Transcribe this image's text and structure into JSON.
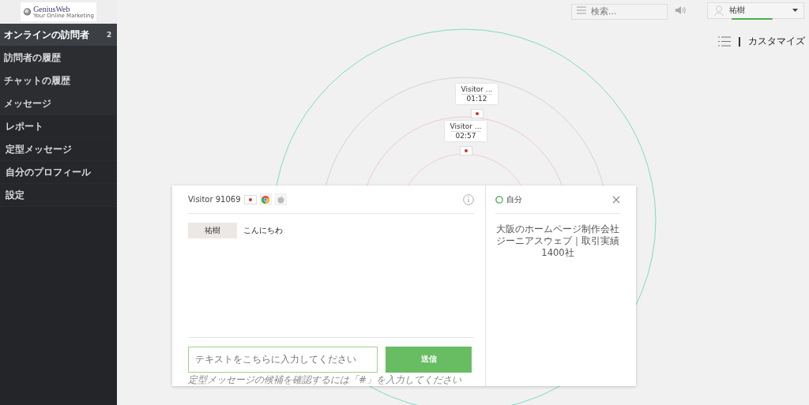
{
  "logo": {
    "name": "GeniusWeb",
    "tagline": "Your Online Marketing"
  },
  "sidebar": {
    "items": [
      {
        "label": "オンラインの訪問者",
        "badge": "2",
        "selected": true
      },
      {
        "label": "訪問者の履歴",
        "selected": false
      },
      {
        "label": "チャットの履歴",
        "selected": false
      },
      {
        "label": "メッセージ",
        "selected": false
      },
      {
        "label": "レポート",
        "selected": false
      },
      {
        "label": "定型メッセージ",
        "selected": false
      },
      {
        "label": "自分のプロフィール",
        "selected": false
      },
      {
        "label": "設定",
        "selected": false
      }
    ]
  },
  "header": {
    "search": {
      "placeholder": "検索..."
    },
    "user": {
      "name": "祐樹"
    }
  },
  "toolbar": {
    "customize": "カスタマイズ"
  },
  "radar": {
    "visitors": [
      {
        "label": "Visitor ...",
        "time": "01:12"
      },
      {
        "label": "Visitor ...",
        "time": "02:57"
      }
    ]
  },
  "chat": {
    "visitor": "Visitor 91069",
    "messages": [
      {
        "sender": "祐樹",
        "text": "こんにちわ"
      }
    ],
    "input": {
      "placeholder": "テキストをこちらに入力してください"
    },
    "send": "送信",
    "hint": "定型メッセージの候補を確認するには「#」を入力してください"
  },
  "profile": {
    "name": "自分",
    "description": "大阪のホームページ制作会社ジーニアスウェブ｜取引実績1400社"
  }
}
